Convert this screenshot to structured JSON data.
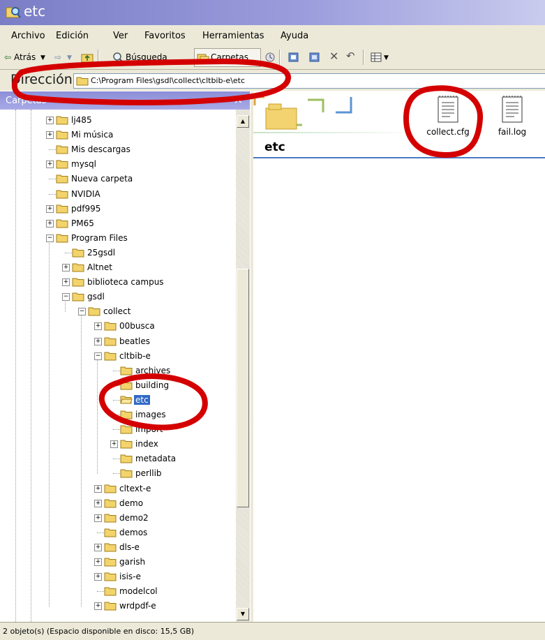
{
  "window": {
    "title": "etc"
  },
  "menu": [
    "Archivo",
    "Edición",
    "Ver",
    "Favoritos",
    "Herramientas",
    "Ayuda"
  ],
  "toolbar": {
    "back_label": "Atrás",
    "search_label": "Búsqueda",
    "folders_label": "Carpetas"
  },
  "address": {
    "label": "Dirección",
    "value": "C:\\Program Files\\gsdl\\collect\\cltbib-e\\etc"
  },
  "folders_pane": {
    "title": "Carpetas",
    "close": "×"
  },
  "tree": [
    {
      "label": "lj485",
      "depth": 0,
      "expander": "+"
    },
    {
      "label": "Mi música",
      "depth": 0,
      "expander": "+"
    },
    {
      "label": "Mis descargas",
      "depth": 0,
      "expander": ""
    },
    {
      "label": "mysql",
      "depth": 0,
      "expander": "+"
    },
    {
      "label": "Nueva carpeta",
      "depth": 0,
      "expander": ""
    },
    {
      "label": "NVIDIA",
      "depth": 0,
      "expander": ""
    },
    {
      "label": "pdf995",
      "depth": 0,
      "expander": "+"
    },
    {
      "label": "PM65",
      "depth": 0,
      "expander": "+"
    },
    {
      "label": "Program Files",
      "depth": 0,
      "expander": "−"
    },
    {
      "label": "25gsdl",
      "depth": 1,
      "expander": ""
    },
    {
      "label": "Altnet",
      "depth": 1,
      "expander": "+"
    },
    {
      "label": "biblioteca campus",
      "depth": 1,
      "expander": "+"
    },
    {
      "label": "gsdl",
      "depth": 1,
      "expander": "−"
    },
    {
      "label": "collect",
      "depth": 2,
      "expander": "−"
    },
    {
      "label": "00busca",
      "depth": 3,
      "expander": "+"
    },
    {
      "label": "beatles",
      "depth": 3,
      "expander": "+"
    },
    {
      "label": "cltbib-e",
      "depth": 3,
      "expander": "−"
    },
    {
      "label": "archives",
      "depth": 4,
      "expander": ""
    },
    {
      "label": "building",
      "depth": 4,
      "expander": ""
    },
    {
      "label": "etc",
      "depth": 4,
      "expander": "",
      "selected": true
    },
    {
      "label": "images",
      "depth": 4,
      "expander": ""
    },
    {
      "label": "import",
      "depth": 4,
      "expander": ""
    },
    {
      "label": "index",
      "depth": 4,
      "expander": "+"
    },
    {
      "label": "metadata",
      "depth": 4,
      "expander": ""
    },
    {
      "label": "perllib",
      "depth": 4,
      "expander": ""
    },
    {
      "label": "cltext-e",
      "depth": 3,
      "expander": "+"
    },
    {
      "label": "demo",
      "depth": 3,
      "expander": "+"
    },
    {
      "label": "demo2",
      "depth": 3,
      "expander": "+"
    },
    {
      "label": "demos",
      "depth": 3,
      "expander": ""
    },
    {
      "label": "dls-e",
      "depth": 3,
      "expander": "+"
    },
    {
      "label": "garish",
      "depth": 3,
      "expander": "+"
    },
    {
      "label": "isis-e",
      "depth": 3,
      "expander": "+"
    },
    {
      "label": "modelcol",
      "depth": 3,
      "expander": ""
    },
    {
      "label": "wrdpdf-e",
      "depth": 3,
      "expander": "+"
    }
  ],
  "content": {
    "heading": "etc",
    "files": [
      {
        "name": "collect.cfg",
        "icon": "text-file-icon"
      },
      {
        "name": "fail.log",
        "icon": "text-file-icon"
      }
    ]
  },
  "status": {
    "text": "2 objeto(s) (Espacio disponible en disco:  15,5 GB)"
  },
  "colors": {
    "selection": "#316ac5",
    "titlebar": "#7b7ec6",
    "annotation": "#d40000",
    "chrome": "#ece9d8"
  }
}
